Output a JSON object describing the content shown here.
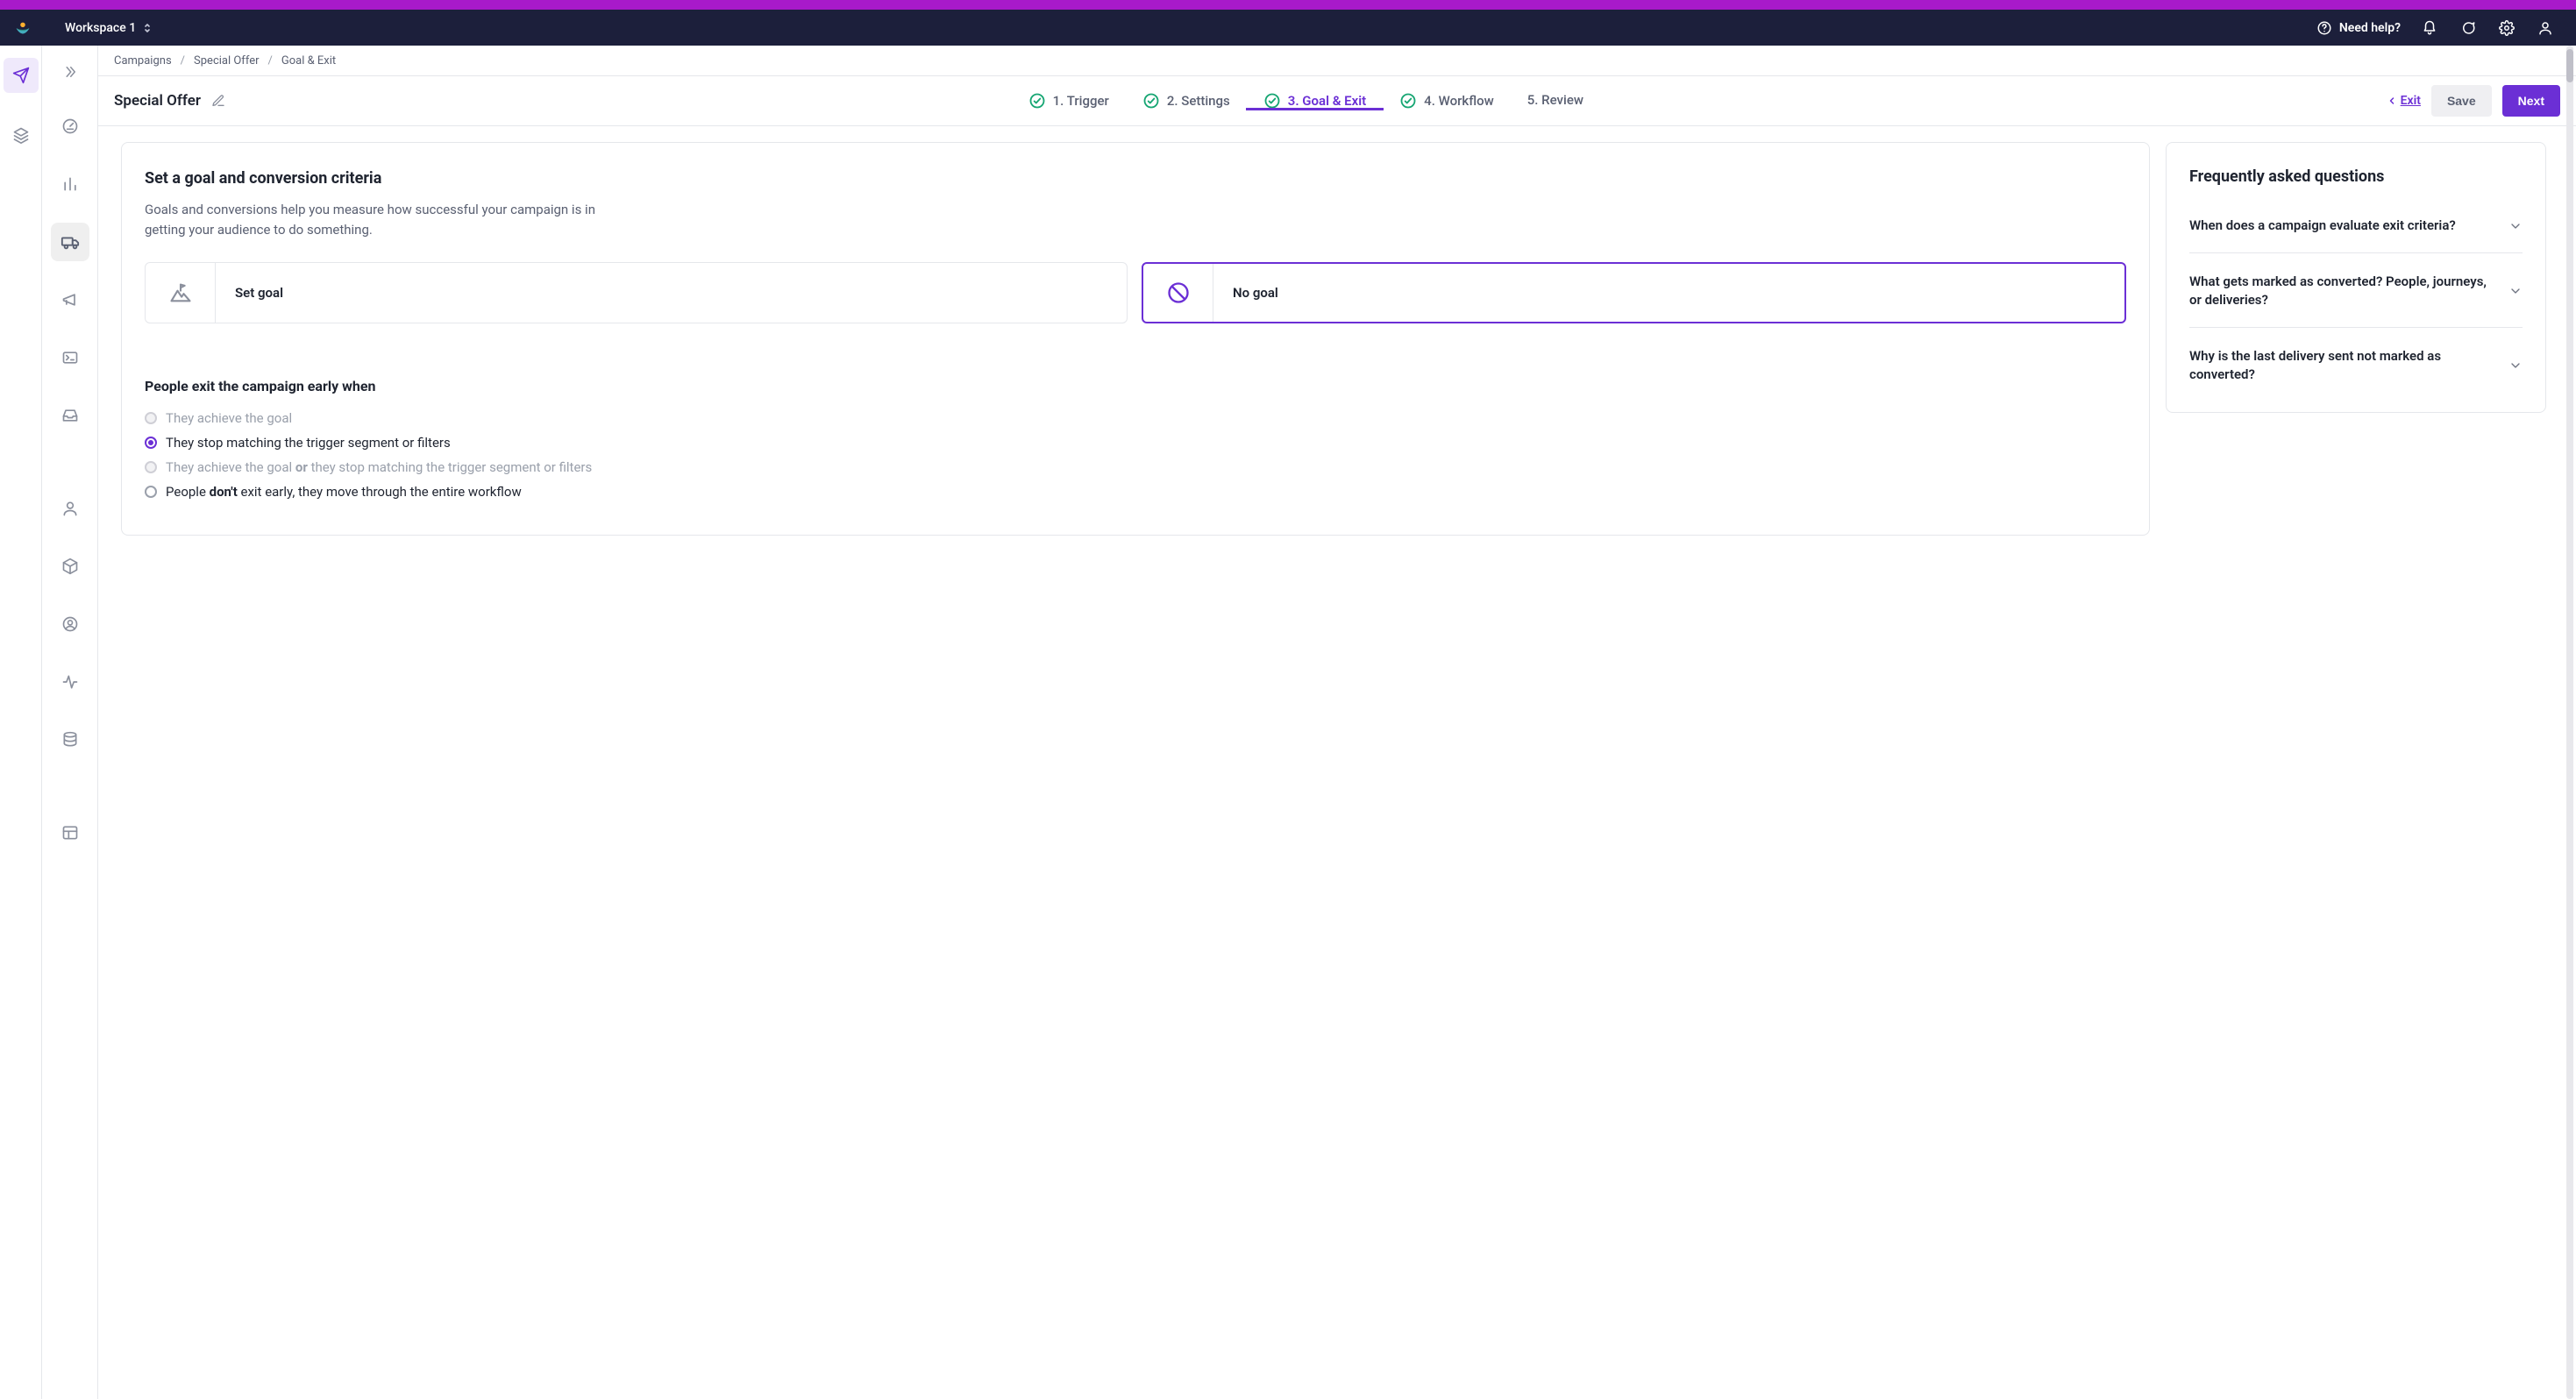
{
  "appbar": {
    "workspace_label": "Workspace 1",
    "need_help": "Need help?"
  },
  "breadcrumb": {
    "items": [
      "Campaigns",
      "Special Offer",
      "Goal & Exit"
    ]
  },
  "subheader": {
    "title": "Special Offer",
    "steps": [
      {
        "label": "1. Trigger",
        "done": true,
        "active": false
      },
      {
        "label": "2. Settings",
        "done": true,
        "active": false
      },
      {
        "label": "3. Goal & Exit",
        "done": true,
        "active": true
      },
      {
        "label": "4. Workflow",
        "done": true,
        "active": false
      },
      {
        "label": "5. Review",
        "done": false,
        "active": false
      }
    ],
    "exit_label": "Exit",
    "save_label": "Save",
    "next_label": "Next"
  },
  "goal": {
    "heading": "Set a goal and conversion criteria",
    "description": "Goals and conversions help you measure how successful your campaign is in getting your audience to do something.",
    "options": [
      {
        "label": "Set goal",
        "selected": false
      },
      {
        "label": "No goal",
        "selected": true
      }
    ]
  },
  "exit": {
    "heading": "People exit the campaign early when",
    "rows": [
      {
        "text_pre": "They achieve the goal",
        "text_bold": "",
        "text_post": "",
        "disabled": true,
        "selected": false
      },
      {
        "text_pre": "They stop matching the trigger segment or filters",
        "text_bold": "",
        "text_post": "",
        "disabled": false,
        "selected": true
      },
      {
        "text_pre": "They achieve the goal ",
        "text_bold": "or",
        "text_post": " they stop matching the trigger segment or filters",
        "disabled": true,
        "selected": false
      },
      {
        "text_pre": "People ",
        "text_bold": "don't",
        "text_post": " exit early, they move through the entire workflow",
        "disabled": false,
        "selected": false
      }
    ]
  },
  "faq": {
    "heading": "Frequently asked questions",
    "items": [
      "When does a campaign evaluate exit criteria?",
      "What gets marked as converted? People, journeys, or deliveries?",
      "Why is the last delivery sent not marked as converted?"
    ]
  }
}
